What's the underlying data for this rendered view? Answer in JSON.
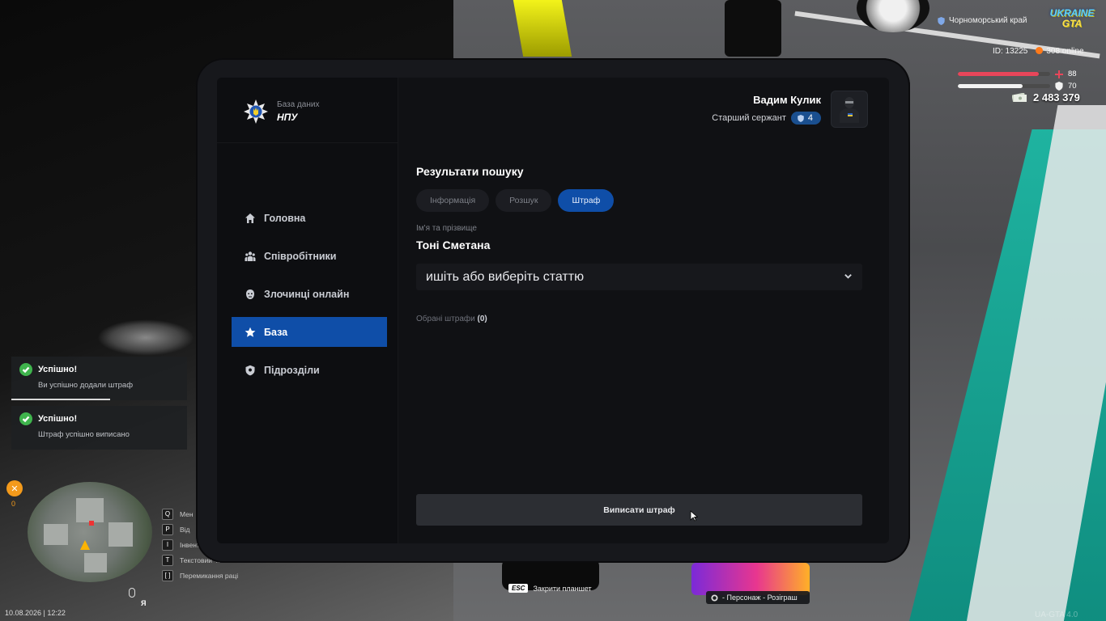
{
  "tablet": {
    "brand": {
      "subtitle": "База даних",
      "name": "НПУ"
    },
    "nav": [
      {
        "label": "Головна",
        "icon": "home-icon",
        "active": false
      },
      {
        "label": "Співробітники",
        "icon": "users-icon",
        "active": false
      },
      {
        "label": "Злочинці онлайн",
        "icon": "mask-icon",
        "active": false
      },
      {
        "label": "База",
        "icon": "star-icon",
        "active": true
      },
      {
        "label": "Підрозділи",
        "icon": "shield-icon",
        "active": false
      }
    ],
    "user": {
      "name": "Вадим Кулик",
      "rank": "Старший сержант",
      "rank_level": "4"
    },
    "search": {
      "title": "Результати пошуку",
      "tabs": [
        {
          "label": "Інформація",
          "active": false
        },
        {
          "label": "Розшук",
          "active": false
        },
        {
          "label": "Штраф",
          "active": true
        }
      ],
      "name_label": "Ім'я та прізвище",
      "name_value": "Тоні Сметана",
      "select_text": "ишіть або виберіть статтю",
      "chosen_label": "Обрані штрафи",
      "chosen_count": "(0)",
      "submit_label": "Виписати штраф"
    },
    "colors": {
      "accent": "#0f4ea8",
      "bg": "#101114",
      "sidebar": "#0d0e11"
    }
  },
  "hud": {
    "region": "Чорноморський край",
    "logo_top": "UKRAINE",
    "logo_bottom": "GTA",
    "player_id": "ID: 13225",
    "online": "308 online",
    "health": {
      "value": "88",
      "fraction": 0.88,
      "color": "#e8465a"
    },
    "armor": {
      "value": "70",
      "fraction": 0.7,
      "color": "#f2f2f2"
    },
    "money": "2 483 379",
    "notifications": [
      {
        "title": "Успішно!",
        "message": "Ви успішно додали штраф",
        "progress": 0.56
      },
      {
        "title": "Успішно!",
        "message": "Штраф успішно виписано",
        "progress": 0.0
      }
    ],
    "mission_count": "0",
    "hotkeys": [
      {
        "key": "Q",
        "label": "Мен"
      },
      {
        "key": "P",
        "label": "Від"
      },
      {
        "key": "I",
        "label": "Інвент"
      },
      {
        "key": "T",
        "label": "Текстовий чат"
      },
      {
        "key": "[ ]",
        "label": "Перемикання раці"
      }
    ],
    "datetime": "10.08.2026 | 12:22",
    "lang": "Я",
    "esc_key": "ESC",
    "esc_label": "Закрити планшет",
    "promo_text": "- Персонаж - Розіграш",
    "watermark": "UA-GTA 4.0"
  }
}
